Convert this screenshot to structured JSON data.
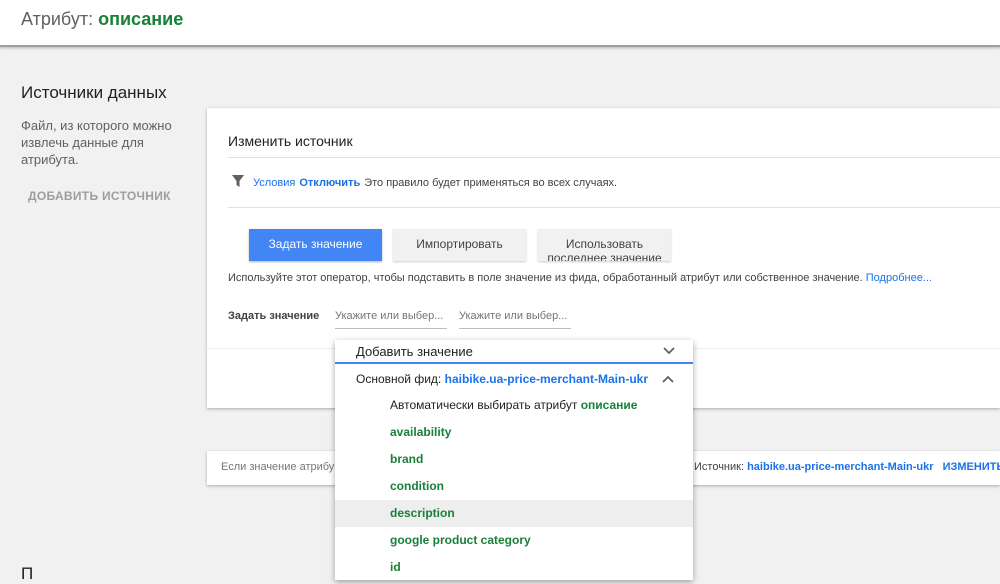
{
  "topbar": {
    "title_prefix": "Атрибут:",
    "attribute": "описание"
  },
  "sources": {
    "title": "Источники данных",
    "description": "Файл, из которого можно извлечь данные для атрибута.",
    "add_button": "ДОБАВИТЬ ИСТОЧНИК"
  },
  "card": {
    "title": "Изменить источник",
    "condition": {
      "link": "Условия",
      "disable": "Отключить",
      "note": "Это правило будет применяться во всех случаях."
    },
    "tabs": [
      "Задать значение",
      "Импортировать",
      "Использовать последнее значение"
    ],
    "help_text": "Используйте этот оператор, чтобы подставить в поле значение из фида, обработанный атрибут или собственное значение.",
    "help_link": "Подробнее...",
    "set_label": "Задать значение",
    "field1_placeholder": "Укажите или выбер...",
    "field2_placeholder": "Укажите или выбер..."
  },
  "strip": {
    "left_text": "Если значение атрибу",
    "source_label": "Источник:",
    "source_name": "haibike.ua-price-merchant-Main-ukr",
    "edit": "ИЗМЕНИТЬ"
  },
  "dropdown": {
    "header": "Добавить значение",
    "feed_label": "Основной фид:",
    "feed_name": "haibike.ua-price-merchant-Main-ukr",
    "auto_label": "Автоматически выбирать атрибут",
    "auto_attr": "описание",
    "items": [
      "availability",
      "brand",
      "condition",
      "description",
      "google product category",
      "id"
    ]
  },
  "bottom_fragment": "П",
  "colors": {
    "accent": "#4285f4",
    "link": "#1a73e8",
    "attribute_green": "#188038"
  }
}
